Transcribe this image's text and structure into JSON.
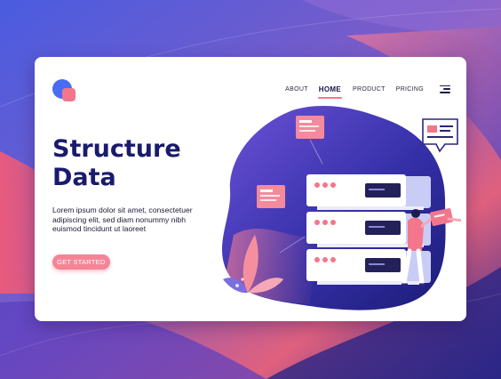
{
  "nav": {
    "items": [
      {
        "label": "ABOUT",
        "active": false
      },
      {
        "label": "HOME",
        "active": true
      },
      {
        "label": "PRODUCT",
        "active": false
      },
      {
        "label": "PRICING",
        "active": false
      }
    ],
    "menu_icon": "hamburger-menu-icon"
  },
  "hero": {
    "title_line1": "Structure",
    "title_line2": "Data",
    "body": "Lorem ipsum dolor sit amet, consectetuer adipiscing elit, sed diam nonummy nibh euismod tincidunt ut laoreet",
    "cta_label": "GET STARTED"
  },
  "logo_icon": "overlapping-circle-square-logo",
  "colors": {
    "accent": "#f4768c",
    "title": "#1a1a6e",
    "logo_blue": "#4a6cf2",
    "illustration_blob": "#3a35b0",
    "background_start": "#4a5ce0",
    "background_end": "#2c2a8c"
  }
}
